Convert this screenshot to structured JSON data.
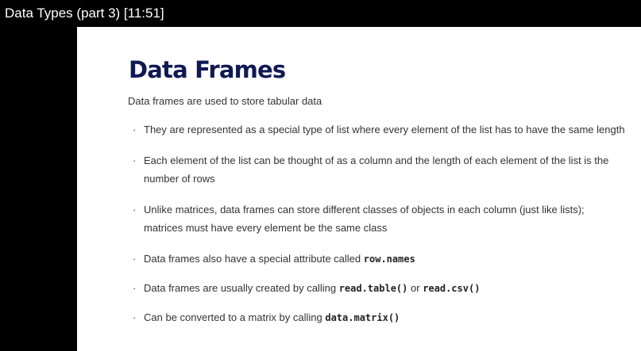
{
  "player": {
    "title": "Data Types (part 3) [11:51]"
  },
  "slide": {
    "title": "Data Frames",
    "subtitle": "Data frames are used to store tabular data",
    "bullets": {
      "b1": "They are represented as a special type of list where every element of the list has to have the same length",
      "b2": "Each element of the list can be thought of as a column and the length of each element of the list is the number of rows",
      "b3": "Unlike matrices, data frames can store different classes of objects in each column (just like lists); matrices must have every element be the same class",
      "b4_text": "Data frames also have a special attribute called ",
      "b4_code": "row.names",
      "b5_text": "Data frames are usually created by calling ",
      "b5_code1": "read.table()",
      "b5_mid": " or ",
      "b5_code2": "read.csv()",
      "b6_text": "Can be converted to a matrix by calling ",
      "b6_code": "data.matrix()"
    },
    "bullet_glyph": "·"
  }
}
